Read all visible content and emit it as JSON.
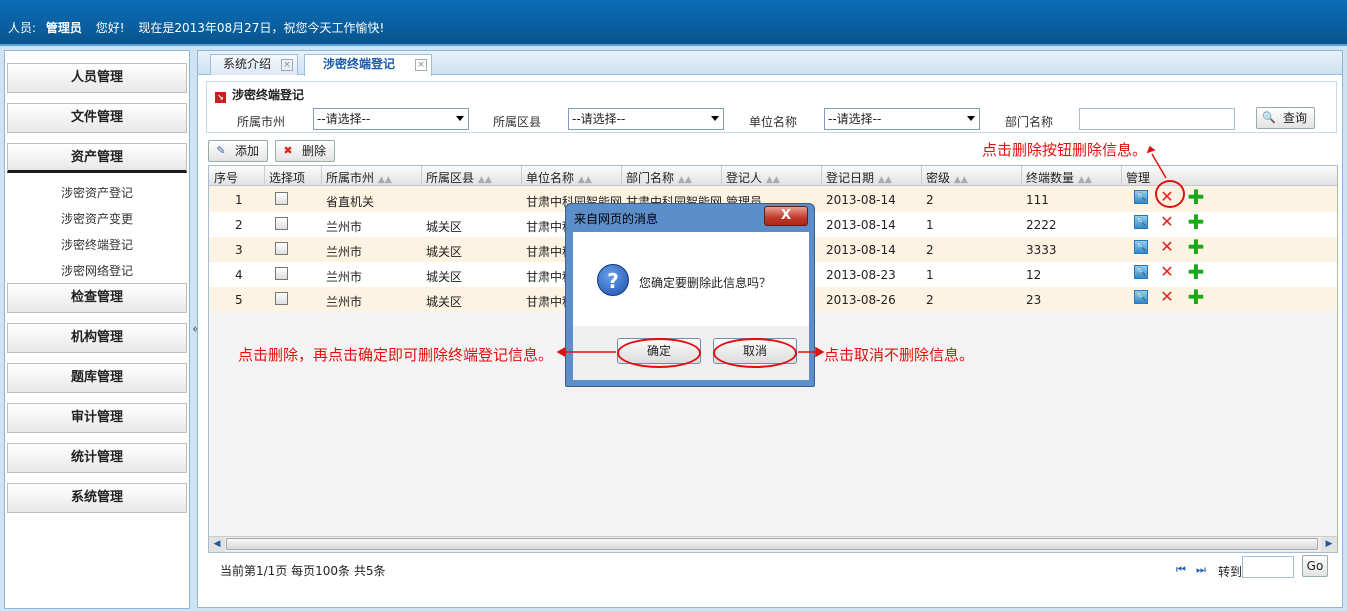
{
  "header": {
    "user_label": "人员:",
    "user_name": "管理员",
    "greeting": "您好!",
    "date_text": "现在是2013年08月27日，祝您今天工作愉快!"
  },
  "sidebar": {
    "menus": [
      "人员管理",
      "文件管理",
      "资产管理",
      "检查管理",
      "机构管理",
      "题库管理",
      "审计管理",
      "统计管理",
      "系统管理"
    ],
    "submenu": [
      "涉密资产登记",
      "涉密资产变更",
      "涉密终端登记",
      "涉密网络登记"
    ],
    "collapse_label": "«"
  },
  "tabs": [
    {
      "label": "系统介绍",
      "close": "×"
    },
    {
      "label": "涉密终端登记",
      "close": "×"
    }
  ],
  "panel": {
    "title": "涉密终端登记",
    "filters": {
      "city_label": "所属市州",
      "city_value": "--请选择--",
      "district_label": "所属区县",
      "district_value": "--请选择--",
      "unit_label": "单位名称",
      "unit_value": "--请选择--",
      "dept_label": "部门名称",
      "dept_value": ""
    },
    "query_button": "查询"
  },
  "toolbar": {
    "add_label": "添加",
    "delete_label": "删除"
  },
  "table": {
    "columns": [
      "序号",
      "选择项",
      "所属市州",
      "所属区县",
      "单位名称",
      "部门名称",
      "登记人",
      "登记日期",
      "密级",
      "终端数量",
      "管理"
    ],
    "rows": [
      {
        "no": "1",
        "city": "省直机关",
        "district": "",
        "unit": "甘肃中科园智能网",
        "dept": "甘肃中科园智能网",
        "registrar": "管理员",
        "date": "2013-08-14",
        "level": "2",
        "count": "111"
      },
      {
        "no": "2",
        "city": "兰州市",
        "district": "城关区",
        "unit": "甘肃中科",
        "dept": "",
        "registrar": "",
        "date": "2013-08-14",
        "level": "1",
        "count": "2222"
      },
      {
        "no": "3",
        "city": "兰州市",
        "district": "城关区",
        "unit": "甘肃中科",
        "dept": "",
        "registrar": "",
        "date": "2013-08-14",
        "level": "2",
        "count": "3333"
      },
      {
        "no": "4",
        "city": "兰州市",
        "district": "城关区",
        "unit": "甘肃中科",
        "dept": "",
        "registrar": "",
        "date": "2013-08-23",
        "level": "1",
        "count": "12"
      },
      {
        "no": "5",
        "city": "兰州市",
        "district": "城关区",
        "unit": "甘肃中科",
        "dept": "",
        "registrar": "",
        "date": "2013-08-26",
        "level": "2",
        "count": "23"
      }
    ]
  },
  "pager": {
    "info": "当前第1/1页  每页100条  共5条",
    "first": "⏮",
    "last": "⏭",
    "goto_label": "转到",
    "go_button": "Go"
  },
  "dialog": {
    "title": "来自网页的消息",
    "close": "X",
    "message": "您确定要删除此信息吗？",
    "ok": "确定",
    "cancel": "取消"
  },
  "annotations": {
    "top": "点击删除按钮删除信息。",
    "left": "点击删除，再点击确定即可删除终端登记信息。",
    "right": "点击取消不删除信息。"
  }
}
